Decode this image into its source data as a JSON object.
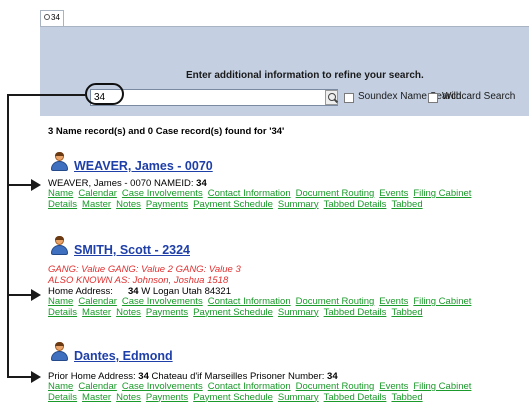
{
  "tab": {
    "label": "34"
  },
  "search": {
    "prompt": "Enter additional information to refine your search.",
    "value": "34",
    "soundex_label": "Soundex Name Search",
    "wildcard_label": "Wildcard Search"
  },
  "results_summary": "3 Name record(s) and 0 Case record(s) found for '34'",
  "records": [
    {
      "title": "WEAVER, James - 0070",
      "detail_prefix": "WEAVER, James - 0070 NAMEID: ",
      "detail_bold": "34"
    },
    {
      "title": "SMITH, Scott - 2324",
      "gang_line": "GANG: Value GANG: Value 2 GANG: Value 3",
      "aka_line": "ALSO KNOWN AS: Johnson, Joshua 1518",
      "addr_label": "Home Address:",
      "addr_bold": "34",
      "addr_rest": " W Logan Utah 84321"
    },
    {
      "title": "Dantes, Edmond",
      "detail_prefix": "Prior Home Address: ",
      "detail_bold": "34",
      "detail_mid": " Chateau d'if Marseilles Prisoner Number: ",
      "detail_bold2": "34"
    }
  ],
  "links_row1": [
    "Name",
    "Calendar",
    "Case Involvements",
    "Contact Information",
    "Document Routing",
    "Events",
    "Filing Cabinet"
  ],
  "links_row2": [
    "Details",
    "Master",
    "Notes",
    "Payments",
    "Payment Schedule",
    "Summary",
    "Tabbed Details",
    "Tabbed"
  ]
}
